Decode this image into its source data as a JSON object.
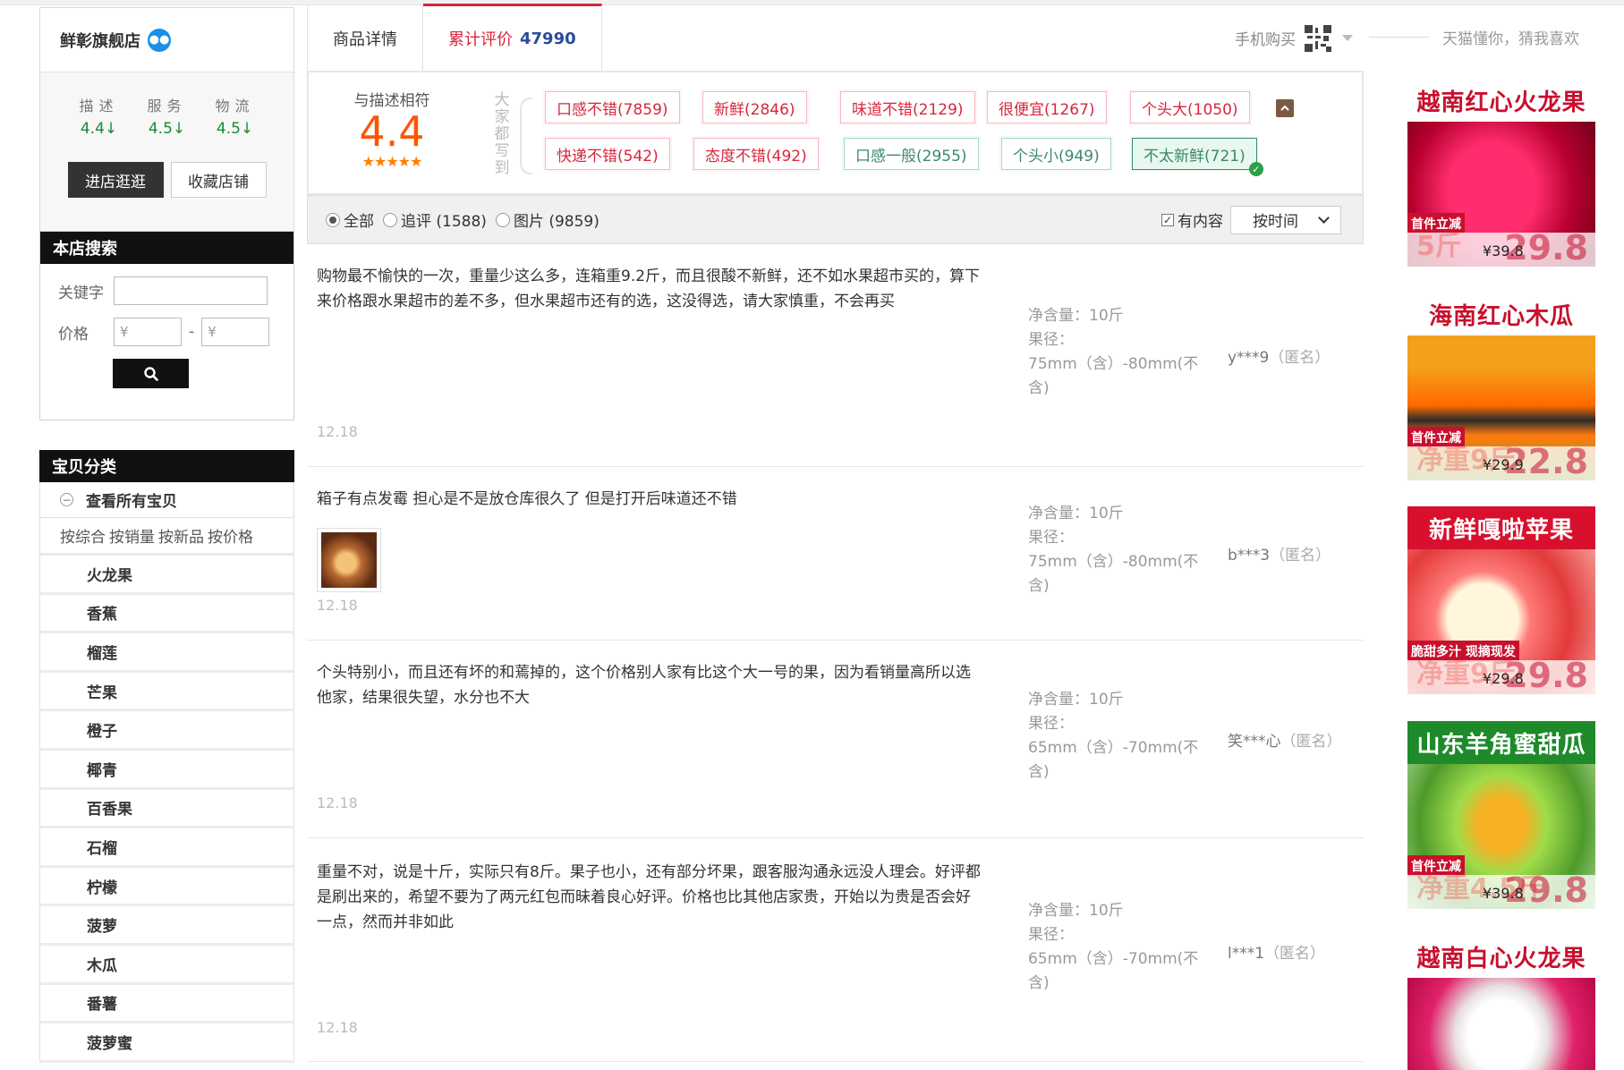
{
  "shop": {
    "name": "鲜彰旗舰店",
    "ratings": [
      {
        "label": "描述",
        "value": "4.4"
      },
      {
        "label": "服务",
        "value": "4.5"
      },
      {
        "label": "物流",
        "value": "4.5"
      }
    ],
    "enter_label": "进店逛逛",
    "fav_label": "收藏店铺"
  },
  "search": {
    "title": "本店搜索",
    "keyword_label": "关键字",
    "price_label": "价格",
    "price_min_placeholder": "¥",
    "price_max_placeholder": "¥",
    "dash": "-"
  },
  "categories": {
    "title": "宝贝分类",
    "all_label": "查看所有宝贝",
    "sorts": [
      "按综合",
      "按销量",
      "按新品",
      "按价格"
    ],
    "items": [
      "火龙果",
      "香蕉",
      "榴莲",
      "芒果",
      "橙子",
      "椰青",
      "百香果",
      "石榴",
      "柠檬",
      "菠萝",
      "木瓜",
      "番薯",
      "菠萝蜜"
    ]
  },
  "tabs": {
    "detail": "商品详情",
    "reviews": "累计评价",
    "reviews_count": "47990",
    "mobile_buy": "手机购买"
  },
  "score": {
    "label": "与描述相符",
    "value": "4.4",
    "stars": "★★★★★",
    "vertical_text": "大家都写到"
  },
  "tags": {
    "row1": [
      "口感不错(7859)",
      "新鲜(2846)",
      "味道不错(2129)",
      "很便宜(1267)",
      "个头大(1050)"
    ],
    "row2_pos": [
      "快递不错(542)",
      "态度不错(492)"
    ],
    "row2_neg": [
      "口感一般(2955)",
      "个头小(949)",
      "不太新鲜(721)"
    ]
  },
  "filter": {
    "all": "全部",
    "followup": "追评 (1588)",
    "pics": "图片 (9859)",
    "has_content": "有内容",
    "sort": "按时间"
  },
  "reviews": [
    {
      "text": "购物最不愉快的一次，重量少这么多，连箱重9.2斤，而且很酸不新鲜，还不如水果超市买的，算下来价格跟水果超市的差不多，但水果超市还有的选，这没得选，请大家慎重，不会再买",
      "date": "12.18",
      "weight": "净含量：10斤",
      "size_label": "果径：",
      "size_value": "75mm（含）-80mm(不含)",
      "user": "y***9",
      "anon": "（匿名）"
    },
    {
      "text": "箱子有点发霉 担心是不是放仓库很久了 但是打开后味道还不错",
      "date": "12.18",
      "weight": "净含量：10斤",
      "size_label": "果径：",
      "size_value": "75mm（含）-80mm(不含)",
      "user": "b***3",
      "anon": "（匿名）"
    },
    {
      "text": "个头特别小，而且还有坏的和蔫掉的，这个价格别人家有比这个大一号的果，因为看销量高所以选他家，结果很失望，水分也不大",
      "date": "12.18",
      "weight": "净含量：10斤",
      "size_label": "果径：",
      "size_value": "65mm（含）-70mm(不含)",
      "user": "笑***心",
      "anon": "（匿名）"
    },
    {
      "text": "重量不对，说是十斤，实际只有8斤。果子也小，还有部分坏果，跟客服沟通永远没人理会。好评都是刷出来的，希望不要为了两元红包而昧着良心好评。价格也比其他店家贵，开始以为贵是否会好一点，然而并非如此",
      "date": "12.18",
      "weight": "净含量：10斤",
      "size_label": "果径：",
      "size_value": "65mm（含）-70mm(不含)",
      "user": "l***1",
      "anon": "（匿名）"
    }
  ],
  "reco": {
    "title": "天猫懂你，猜我喜欢",
    "items": [
      {
        "title": "越南红心火龙果",
        "badge": "首件立减",
        "price": "¥39.8",
        "big": "29.8",
        "ghost": "5斤",
        "color": "#c8102e"
      },
      {
        "title": "海南红心木瓜",
        "badge": "首件立减",
        "price": "¥29.9",
        "big": "22.8",
        "ghost": "净重9斤",
        "color": "#c8102e"
      },
      {
        "title": "新鲜嘎啦苹果",
        "badge": "脆甜多汁 现摘现发",
        "price": "¥29.8",
        "big": "29.8",
        "ghost": "净重9斤",
        "color": "#ffffff"
      },
      {
        "title": "山东羊角蜜甜瓜",
        "badge": "首件立减",
        "price": "¥39.8",
        "big": "29.8",
        "ghost": "净重4.5斤",
        "color": "#ffffff"
      },
      {
        "title": "越南白心火龙果",
        "badge": "",
        "price": "",
        "big": "",
        "ghost": "",
        "color": "#c8102e"
      }
    ]
  }
}
